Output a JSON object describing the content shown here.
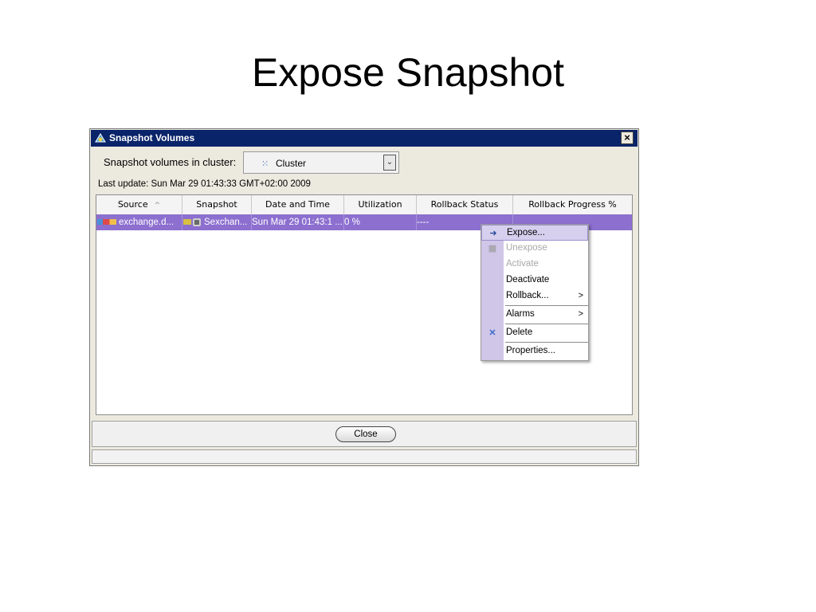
{
  "slide": {
    "title": "Expose Snapshot"
  },
  "window": {
    "title": "Snapshot Volumes",
    "close_glyph": "×",
    "cluster_label": "Snapshot volumes in cluster:",
    "cluster_value": "Cluster",
    "cluster_icon_glyph": "⁙",
    "dropdown_glyph": "⌄",
    "last_update": "Last update: Sun Mar 29 01:43:33 GMT+02:00 2009"
  },
  "table": {
    "headers": [
      "Source",
      "Snapshot",
      "Date and Time",
      "Utilization",
      "Rollback Status",
      "Rollback Progress %"
    ],
    "sort_glyph": "^",
    "rows": [
      {
        "source": "exchange.d...",
        "snapshot": "Sexchan...",
        "date_time": "Sun Mar 29 01:43:1 ...",
        "utilization": "0 %",
        "rollback_status": "----",
        "rollback_progress": ""
      }
    ]
  },
  "footer": {
    "close_label": "Close"
  },
  "context_menu": {
    "items": [
      {
        "label": "Expose...",
        "enabled": true,
        "highlighted": true,
        "icon": "expose-icon",
        "glyph": "➜"
      },
      {
        "label": "Unexpose",
        "enabled": false,
        "icon": "unexpose-icon",
        "glyph": "▩"
      },
      {
        "label": "Activate",
        "enabled": false
      },
      {
        "label": "Deactivate",
        "enabled": true
      },
      {
        "label": "Rollback...",
        "enabled": true,
        "submenu_glyph": ">"
      },
      {
        "label": "Alarms",
        "enabled": true,
        "submenu_glyph": ">"
      },
      {
        "label": "Delete",
        "enabled": true,
        "icon": "delete-icon",
        "glyph": "✕"
      },
      {
        "label": "Properties...",
        "enabled": true
      }
    ]
  }
}
